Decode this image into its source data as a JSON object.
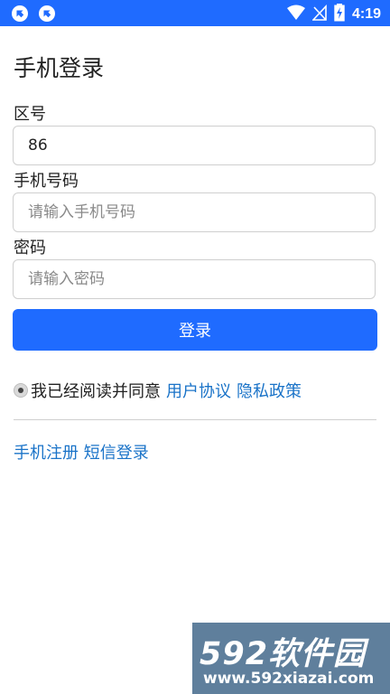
{
  "status_bar": {
    "time": "4:19",
    "left_icons": [
      "sync-icon",
      "sync-icon"
    ],
    "right_icons": [
      "wifi-icon",
      "no-signal-icon",
      "battery-charging-icon"
    ],
    "color": "#1f6bff"
  },
  "page": {
    "title": "手机登录"
  },
  "form": {
    "area_code": {
      "label": "区号",
      "value": "86"
    },
    "phone": {
      "label": "手机号码",
      "placeholder": "请输入手机号码"
    },
    "password": {
      "label": "密码",
      "placeholder": "请输入密码"
    },
    "login_label": "登录"
  },
  "agreement": {
    "text": "我已经阅读并同意",
    "user_agreement": "用户协议",
    "privacy_policy": "隐私政策"
  },
  "bottom_links": {
    "register": "手机注册",
    "sms_login": "短信登录"
  },
  "watermark": {
    "brand": "592软件园",
    "url": "www.592xiazai.com"
  },
  "colors": {
    "accent": "#1f6bff",
    "link": "#1a73c8"
  }
}
